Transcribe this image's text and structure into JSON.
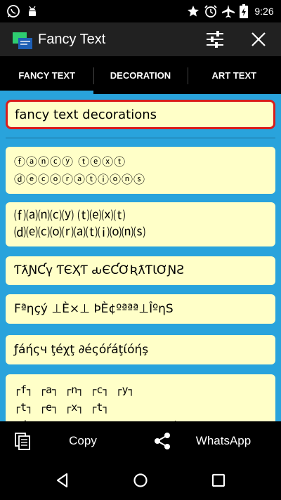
{
  "status_bar": {
    "time": "9:26",
    "left_icons": [
      "whatsapp-icon",
      "android-icon"
    ],
    "right_icons": [
      "star-icon",
      "alarm-icon",
      "airplane-icon",
      "battery-icon"
    ]
  },
  "app_bar": {
    "title": "Fancy Text",
    "actions": [
      "settings-sliders-icon",
      "close-icon"
    ]
  },
  "tabs": [
    {
      "label": "FANCY TEXT",
      "active": true
    },
    {
      "label": "DECORATION",
      "active": false
    },
    {
      "label": "ART TEXT",
      "active": false
    }
  ],
  "input": {
    "value": "fancy text decorations"
  },
  "results": [
    {
      "text": "ⓕⓐⓝⓒⓨ ⓣⓔⓧⓣ\nⓓⓔⓒⓞⓡⓐⓣⓘⓞⓝⓢ"
    },
    {
      "text": "⒡⒜⒩⒞⒴ ⒯⒠⒳⒯\n⒟⒠⒞⒪⒭⒜⒯⒤⒪⒩⒮"
    },
    {
      "text": "ƬƛƝƇү ƬЄҲƬ ԃЄƇƠƦƛƬƖƠƝƧ"
    },
    {
      "text": "Fªηçý ⊥È×⊥ ÞÈ¢ºªªª⊥ÎºηS"
    },
    {
      "text": "ƒáήςч ţéχţ ∂éςóŕáţίóήş"
    },
    {
      "text": "┌f┐ ┌a┐ ┌n┐ ┌c┐ ┌y┐\n┌t┐ ┌e┐ ┌x┐ ┌t┐\n┌d┐ ┌e┐ ┌c┐ ┌o┐ ┌r┐ ┌a┐ ┌t┐"
    }
  ],
  "action_bar": {
    "copy_label": "Copy",
    "share_label": "WhatsApp"
  },
  "nav_bar": {
    "buttons": [
      "back-icon",
      "home-icon",
      "recents-icon"
    ]
  },
  "colors": {
    "accent": "#29a3dc",
    "card_bg": "#ffffc8",
    "input_border": "#d91c1c",
    "app_bar": "#212121"
  }
}
